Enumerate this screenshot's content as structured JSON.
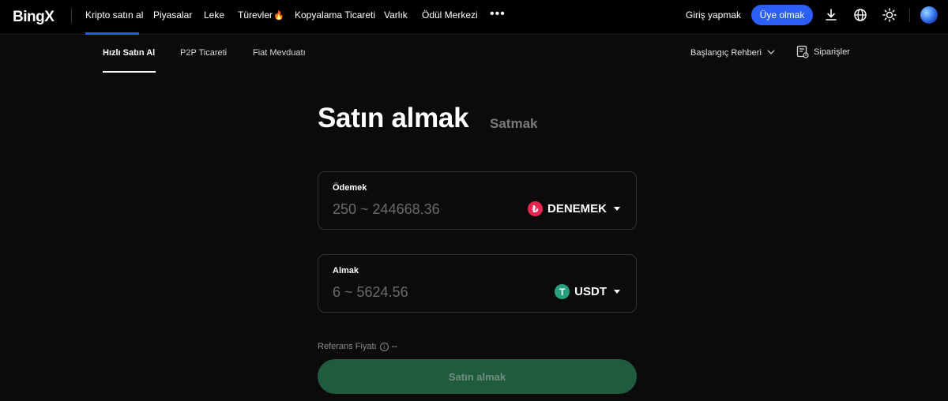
{
  "header": {
    "logo": "BingX",
    "nav": [
      {
        "label": "Kripto satın al",
        "active": true
      },
      {
        "label": "Piyasalar"
      },
      {
        "label": "Leke"
      },
      {
        "label": "Türevler"
      },
      {
        "label": "Kopyalama Ticareti"
      },
      {
        "label": "Varlık"
      },
      {
        "label": "Ödül Merkezi"
      }
    ],
    "more": "•••",
    "login": "Giriş yapmak",
    "signup": "Üye olmak",
    "icons": [
      "download-icon",
      "globe-icon",
      "sun-icon",
      "avatar"
    ],
    "accent": "#2c5ff6"
  },
  "subnav": {
    "items": [
      {
        "label": "Hızlı Satın Al",
        "active": true
      },
      {
        "label": "P2P Ticareti"
      },
      {
        "label": "Fiat Mevduatı"
      }
    ],
    "guide": "Başlangıç Rehberi",
    "orders": "Siparişler"
  },
  "main": {
    "tab_buy": "Satın almak",
    "tab_sell": "Satmak",
    "pay": {
      "label": "Ödemek",
      "placeholder": "250 ~ 244668.36",
      "currency": "DENEMEK",
      "currency_symbol": "₺",
      "currency_color": "#e8254e"
    },
    "receive": {
      "label": "Almak",
      "placeholder": "6 ~ 5624.56",
      "currency": "USDT",
      "currency_symbol": "T",
      "currency_color": "#26a17b"
    },
    "ref_price_label": "Referans Fiyatı",
    "ref_price_value": "--",
    "submit": "Satın almak"
  }
}
